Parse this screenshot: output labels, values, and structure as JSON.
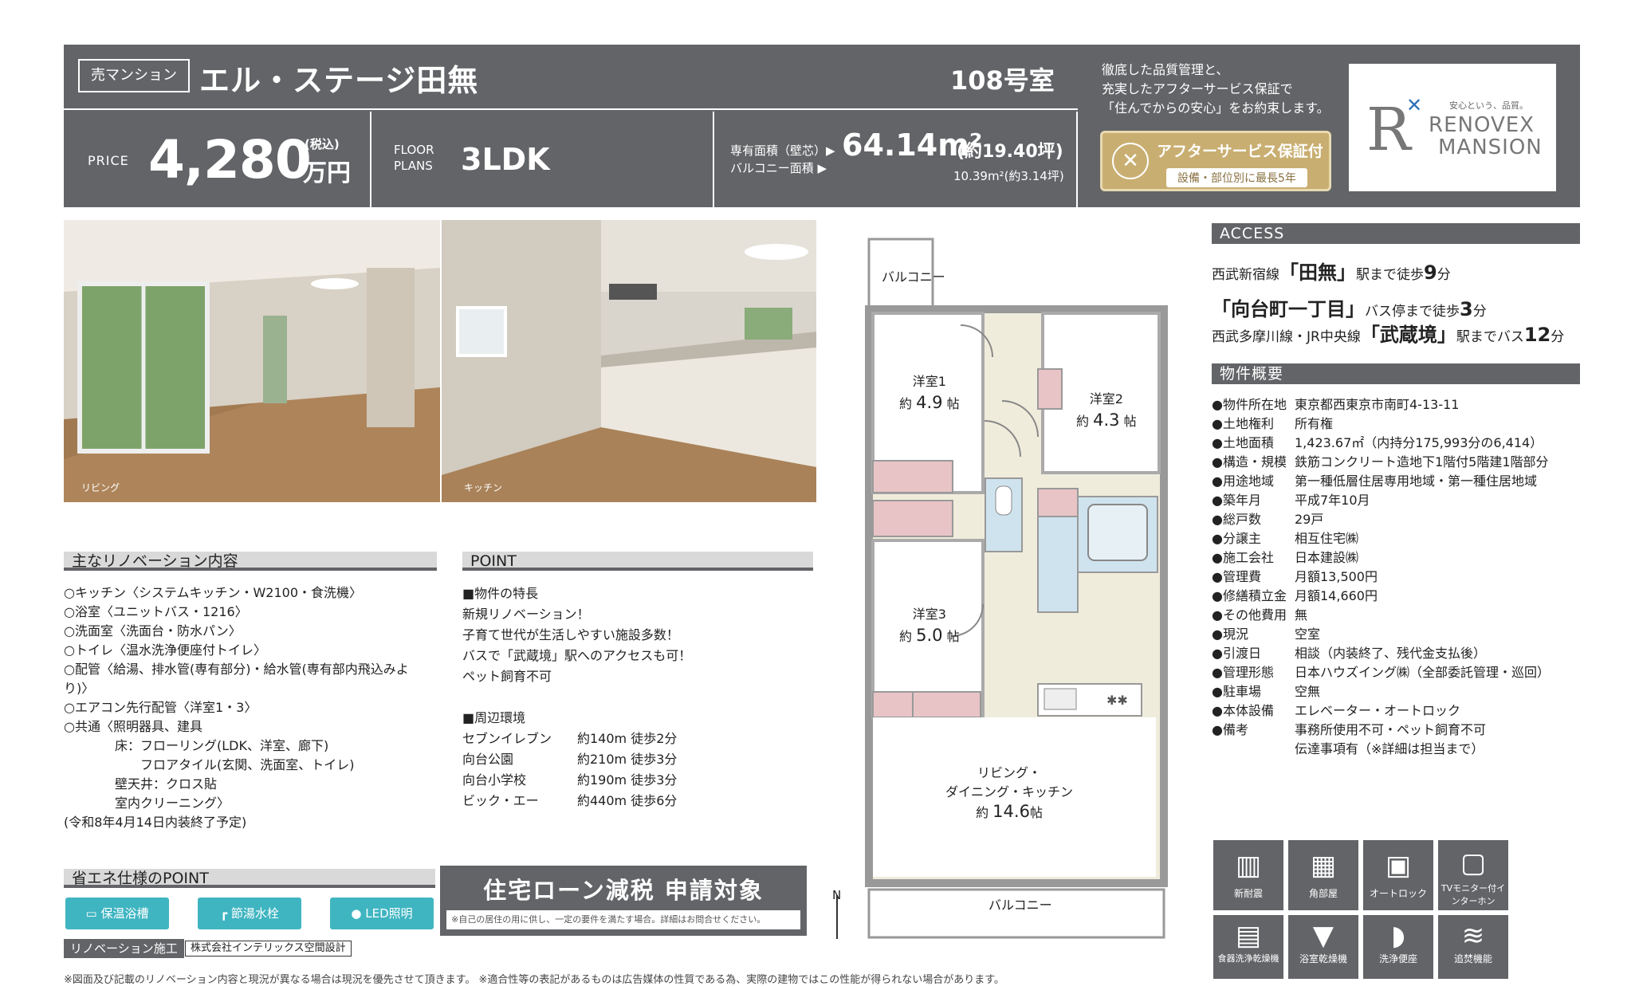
{
  "header": {
    "tag": "売マンション",
    "name": "エル・ステージ田無",
    "room": "108号室",
    "price_label": "PRICE",
    "price": "4,280",
    "tax": "(税込)",
    "price_unit": "万円",
    "floor_label1": "FLOOR",
    "floor_label2": "PLANS",
    "layout": "3LDK",
    "area_label1": "専有面積（壁芯）▶",
    "area_label2": "バルコニー面積 ▶",
    "area": "64.14m²",
    "area_tsubo": "(約19.40坪)",
    "balcony": "10.39m²(約3.14坪)"
  },
  "promo": {
    "line1": "徹底した品質管理と、",
    "line2": "充実したアフターサービス保証で",
    "line3": "「住んでからの安心」をお約束します。",
    "badge_title": "アフターサービス保証付",
    "badge_sub": "設備・部位別に最長5年"
  },
  "logo": {
    "tagline": "安心という、品質。",
    "name1": "RENOVEX",
    "name2": "MANSION"
  },
  "photos": [
    {
      "caption": "リビング"
    },
    {
      "caption": "キッチン"
    }
  ],
  "renovation": {
    "title": "主なリノベーション内容",
    "lines": [
      "○キッチン〈システムキッチン・W2100・食洗機〉",
      "○浴室〈ユニットバス・1216〉",
      "○洗面室〈洗面台・防水パン〉",
      "○トイレ〈温水洗浄便座付トイレ〉",
      "○配管〈給湯、排水管(専有部分)・給水管(専有部内飛込みよ",
      "り)〉",
      "○エアコン先行配管〈洋室1・3〉",
      "○共通〈照明器具、建具",
      "　　　　床：フローリング(LDK、洋室、廊下)",
      "　　　　　　フロアタイル(玄関、洗面室、トイレ)",
      "　　　　壁天井：クロス貼",
      "　　　　室内クリーニング〉",
      "(令和8年4月14日内装終了予定)"
    ]
  },
  "point": {
    "title": "POINT",
    "lines": [
      "■物件の特長",
      "新規リノベーション！",
      "子育て世代が生活しやすい施設多数！",
      "バスで「武蔵境」駅へのアクセスも可！",
      "ペット飼育不可",
      "",
      "■周辺環境"
    ],
    "env": [
      [
        "セブンイレブン",
        "約140m 徒歩2分"
      ],
      [
        "向台公園",
        "約210m 徒歩3分"
      ],
      [
        "向台小学校",
        "約190m 徒歩3分"
      ],
      [
        "ビック・エー",
        "約440m 徒歩6分"
      ]
    ]
  },
  "eco": {
    "title": "省エネ仕様のPOINT",
    "items": [
      "保温浴槽",
      "節湯水栓",
      "LED照明"
    ],
    "reno_label": "リノベーション施工",
    "company": "株式会社インテリックス空間設計"
  },
  "loan": {
    "title": "住宅ローン減税 申請対象",
    "note": "※自己の居住の用に供し、一定の要件を満たす場合。詳細はお問合せください。"
  },
  "floorplan": {
    "balcony_top": "バルコニー",
    "balcony_bottom": "バルコニー",
    "r1": "洋室1",
    "r1a": "約",
    "r1v": "4.9",
    "r1u": "帖",
    "r2": "洋室2",
    "r2a": "約",
    "r2v": "4.3",
    "r2u": "帖",
    "r3": "洋室3",
    "r3a": "約",
    "r3v": "5.0",
    "r3u": "帖",
    "ldk1": "リビング・",
    "ldk2": "ダイニング・キッチン",
    "ldka": "約",
    "ldkv": "14.6",
    "ldku": "帖",
    "north": "N"
  },
  "access": {
    "title": "ACCESS",
    "l1a": "西武新宿線",
    "l1b": "「田無」",
    "l1c": "駅まで徒歩",
    "l1d": "9",
    "l1e": "分",
    "l2b": "「向台町一丁目」",
    "l2c": "バス停まで徒歩",
    "l2d": "3",
    "l2e": "分",
    "l3a": "西武多摩川線・JR中央線",
    "l3b": "「武蔵境」",
    "l3c": "駅までバス",
    "l3d": "12",
    "l3e": "分"
  },
  "overview": {
    "title": "物件概要",
    "rows": [
      [
        "●物件所在地",
        "東京都西東京市南町4-13-11"
      ],
      [
        "●土地権利",
        "所有権"
      ],
      [
        "●土地面積",
        "1,423.67㎡（内持分175,993分の6,414）"
      ],
      [
        "●構造・規模",
        "鉄筋コンクリート造地下1階付5階建1階部分"
      ],
      [
        "●用途地域",
        "第一種低層住居専用地域・第一種住居地域"
      ],
      [
        "●築年月",
        "平成7年10月"
      ],
      [
        "●総戸数",
        "29戸"
      ],
      [
        "●分譲主",
        "相互住宅㈱"
      ],
      [
        "●施工会社",
        "日本建設㈱"
      ],
      [
        "●管理費",
        "月額13,500円"
      ],
      [
        "●修繕積立金",
        "月額14,660円"
      ],
      [
        "●その他費用",
        "無"
      ],
      [
        "●現況",
        "空室"
      ],
      [
        "●引渡日",
        "相談（内装終了、残代金支払後）"
      ],
      [
        "●管理形態",
        "日本ハウズイング㈱（全部委託管理・巡回）"
      ],
      [
        "●駐車場",
        "空無"
      ],
      [
        "●本体設備",
        "エレベーター・オートロック"
      ],
      [
        "●備考",
        "事務所使用不可・ペット飼育不可"
      ],
      [
        "",
        "伝達事項有（※詳細は担当まで）"
      ]
    ]
  },
  "features": [
    "新耐震",
    "角部屋",
    "オートロック",
    "TVモニター付インターホン",
    "食器洗浄乾燥機",
    "浴室乾燥機",
    "洗浄便座",
    "追焚機能"
  ],
  "footer": "※図面及び記載のリノベーション内容と現況が異なる場合は現況を優先させて頂きます。 ※適合性等の表記があるものは広告媒体の性質である為、実際の建物ではこの性能が得られない場合があります。"
}
